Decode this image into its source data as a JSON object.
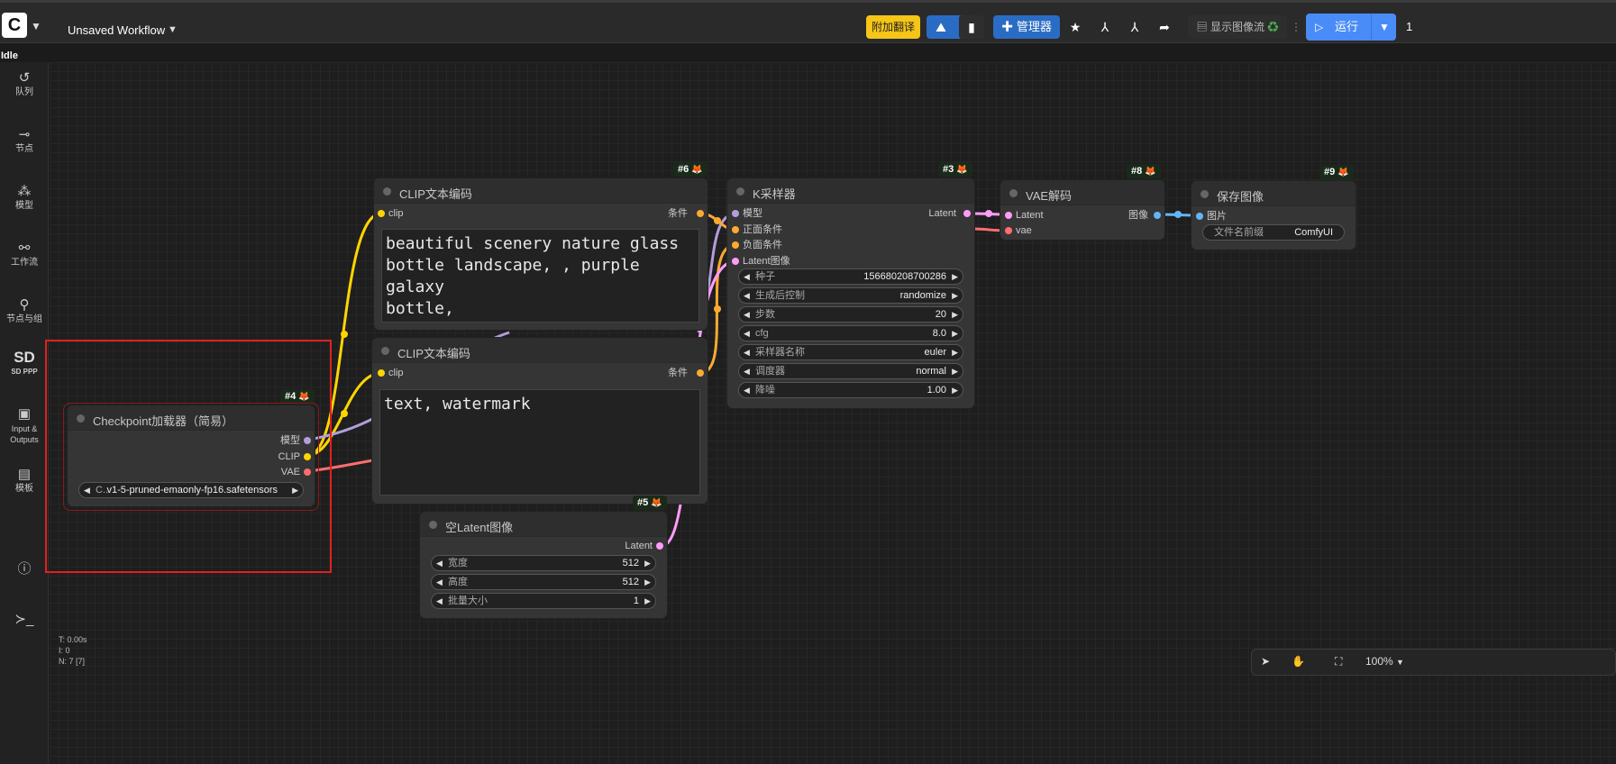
{
  "topbar": {
    "logo_icon": "comfy-logo-icon",
    "workflow_title": "Unsaved Workflow",
    "translate_label": "附加翻译",
    "manager_label": "管理器",
    "show_image_flow_label": "显示图像流",
    "run_label": "运行",
    "status": "Idle",
    "partial_right": "1"
  },
  "sidebar": {
    "items": [
      {
        "icon": "history-icon",
        "label": "队列"
      },
      {
        "icon": "node-icon",
        "label": "节点"
      },
      {
        "icon": "model-icon",
        "label": "模型"
      },
      {
        "icon": "workflow-icon",
        "label": "工作流"
      },
      {
        "icon": "node-group-icon",
        "label": "节点与组"
      },
      {
        "icon": "sd-ppp-icon",
        "label": "SD PPP",
        "logo_text": "SD"
      },
      {
        "icon": "image-icon",
        "label": "Input & Outputs"
      },
      {
        "icon": "template-icon",
        "label": "模板"
      }
    ],
    "help_icon": "help-icon",
    "terminal_icon": "terminal-icon"
  },
  "nodes": {
    "checkpoint": {
      "id": "#4",
      "title": "Checkpoint加载器（简易）",
      "outputs": [
        "模型",
        "CLIP",
        "VAE"
      ],
      "ckpt_label": "C...",
      "ckpt_value": "v1-5-pruned-emaonly-fp16.safetensors"
    },
    "clip_pos": {
      "id": "#6",
      "title": "CLIP文本编码",
      "input": "clip",
      "output": "条件",
      "text": "beautiful scenery nature glass\nbottle landscape, , purple galaxy\nbottle,"
    },
    "clip_neg": {
      "id": "#7",
      "title": "CLIP文本编码",
      "input": "clip",
      "output": "条件",
      "text": "text, watermark"
    },
    "latent": {
      "id": "#5",
      "title": "空Latent图像",
      "output": "Latent",
      "width_label": "宽度",
      "width": "512",
      "height_label": "高度",
      "height": "512",
      "batch_label": "批量大小",
      "batch": "1"
    },
    "ksampler": {
      "id": "#3",
      "title": "K采样器",
      "inputs": [
        "模型",
        "正面条件",
        "负面条件",
        "Latent图像"
      ],
      "output": "Latent",
      "widgets": [
        {
          "label": "种子",
          "value": "156680208700286"
        },
        {
          "label": "生成后控制",
          "value": "randomize"
        },
        {
          "label": "步数",
          "value": "20"
        },
        {
          "label": "cfg",
          "value": "8.0"
        },
        {
          "label": "采样器名称",
          "value": "euler"
        },
        {
          "label": "调度器",
          "value": "normal"
        },
        {
          "label": "降噪",
          "value": "1.00"
        }
      ]
    },
    "vae_decode": {
      "id": "#8",
      "title": "VAE解码",
      "inputs": [
        "Latent",
        "vae"
      ],
      "output": "图像"
    },
    "save_image": {
      "id": "#9",
      "title": "保存图像",
      "input": "图片",
      "prefix_label": "文件名前缀",
      "prefix_value": "ComfyUI"
    }
  },
  "stats": {
    "t": "T: 0.00s",
    "i": "I: 0",
    "n": "N: 7 [7]"
  },
  "zoom": {
    "level": "100%"
  },
  "colors": {
    "model": "#b39ddb",
    "clip": "#ffd500",
    "vae": "#ff6e6e",
    "conditioning": "#ffa931",
    "latent": "#ff9cf9",
    "image": "#64b5f6",
    "run_button": "#4a8cf7",
    "manager_button": "#2a6cc4",
    "translate_button": "#f5c518",
    "selection_outline": "#e02020"
  }
}
